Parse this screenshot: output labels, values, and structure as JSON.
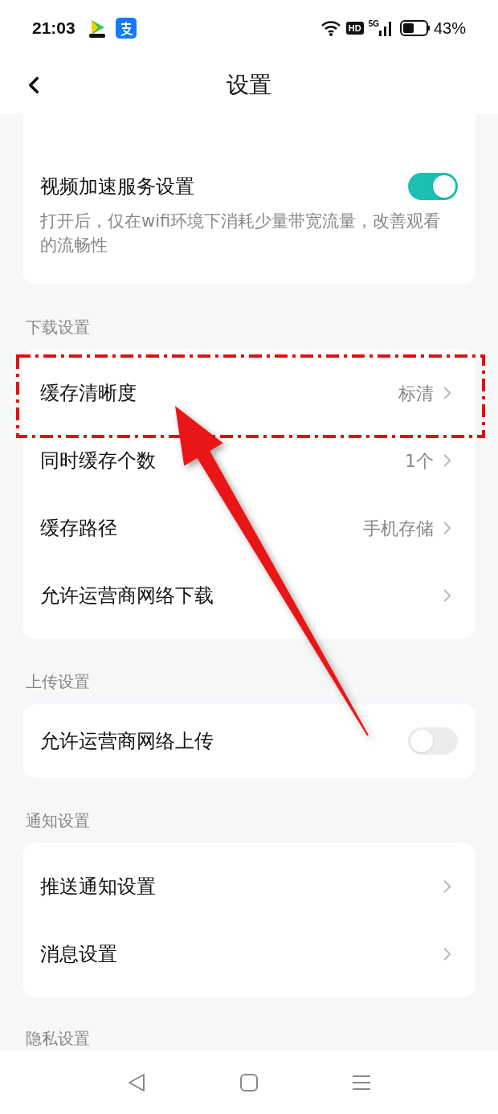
{
  "status_bar": {
    "time": "21:03",
    "hd_badge": "HD",
    "network": "5G",
    "battery": "43%"
  },
  "header": {
    "title": "设置"
  },
  "video_card": {
    "title": "视频加速服务设置",
    "description": "打开后，仅在wifi环境下消耗少量带宽流量，改善观看的流畅性",
    "on": true
  },
  "sections": [
    {
      "label": "下载设置",
      "rows": [
        {
          "kind": "link",
          "title": "缓存清晰度",
          "value": "标清"
        },
        {
          "kind": "link",
          "title": "同时缓存个数",
          "value": "1个"
        },
        {
          "kind": "link",
          "title": "缓存路径",
          "value": "手机存储"
        },
        {
          "kind": "link",
          "title": "允许运营商网络下载"
        }
      ]
    },
    {
      "label": "上传设置",
      "rows": [
        {
          "kind": "toggle",
          "title": "允许运营商网络上传",
          "on": false
        }
      ]
    },
    {
      "label": "通知设置",
      "rows": [
        {
          "kind": "link",
          "title": "推送通知设置"
        },
        {
          "kind": "link",
          "title": "消息设置"
        }
      ]
    }
  ],
  "partial_section_label": "隐私设置"
}
